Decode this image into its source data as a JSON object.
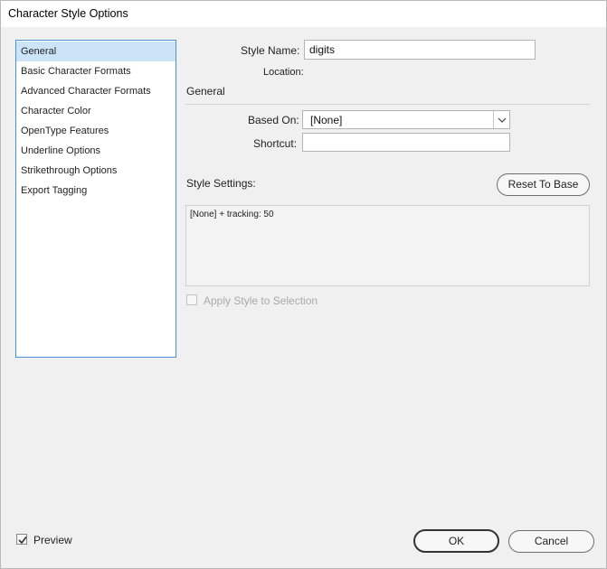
{
  "window": {
    "title": "Character Style Options"
  },
  "nav": {
    "items": [
      {
        "label": "General",
        "selected": true
      },
      {
        "label": "Basic Character Formats",
        "selected": false
      },
      {
        "label": "Advanced Character Formats",
        "selected": false
      },
      {
        "label": "Character Color",
        "selected": false
      },
      {
        "label": "OpenType Features",
        "selected": false
      },
      {
        "label": "Underline Options",
        "selected": false
      },
      {
        "label": "Strikethrough Options",
        "selected": false
      },
      {
        "label": "Export Tagging",
        "selected": false
      }
    ]
  },
  "form": {
    "style_name_label": "Style Name:",
    "style_name_value": "digits",
    "location_label": "Location:",
    "section_title": "General",
    "based_on_label": "Based On:",
    "based_on_value": "[None]",
    "shortcut_label": "Shortcut:",
    "shortcut_value": "",
    "style_settings_label": "Style Settings:",
    "reset_button": "Reset To Base",
    "style_settings_text": "[None] + tracking: 50",
    "apply_style_label": "Apply Style to Selection",
    "apply_style_checked": false,
    "apply_style_enabled": false
  },
  "footer": {
    "preview_label": "Preview",
    "preview_checked": true,
    "ok_button": "OK",
    "cancel_button": "Cancel"
  },
  "colors": {
    "accent_border": "#4a90d9",
    "selected_bg": "#cce4f7"
  },
  "icons": {
    "dropdown": "chevron-down-icon",
    "check": "checkmark-icon"
  }
}
